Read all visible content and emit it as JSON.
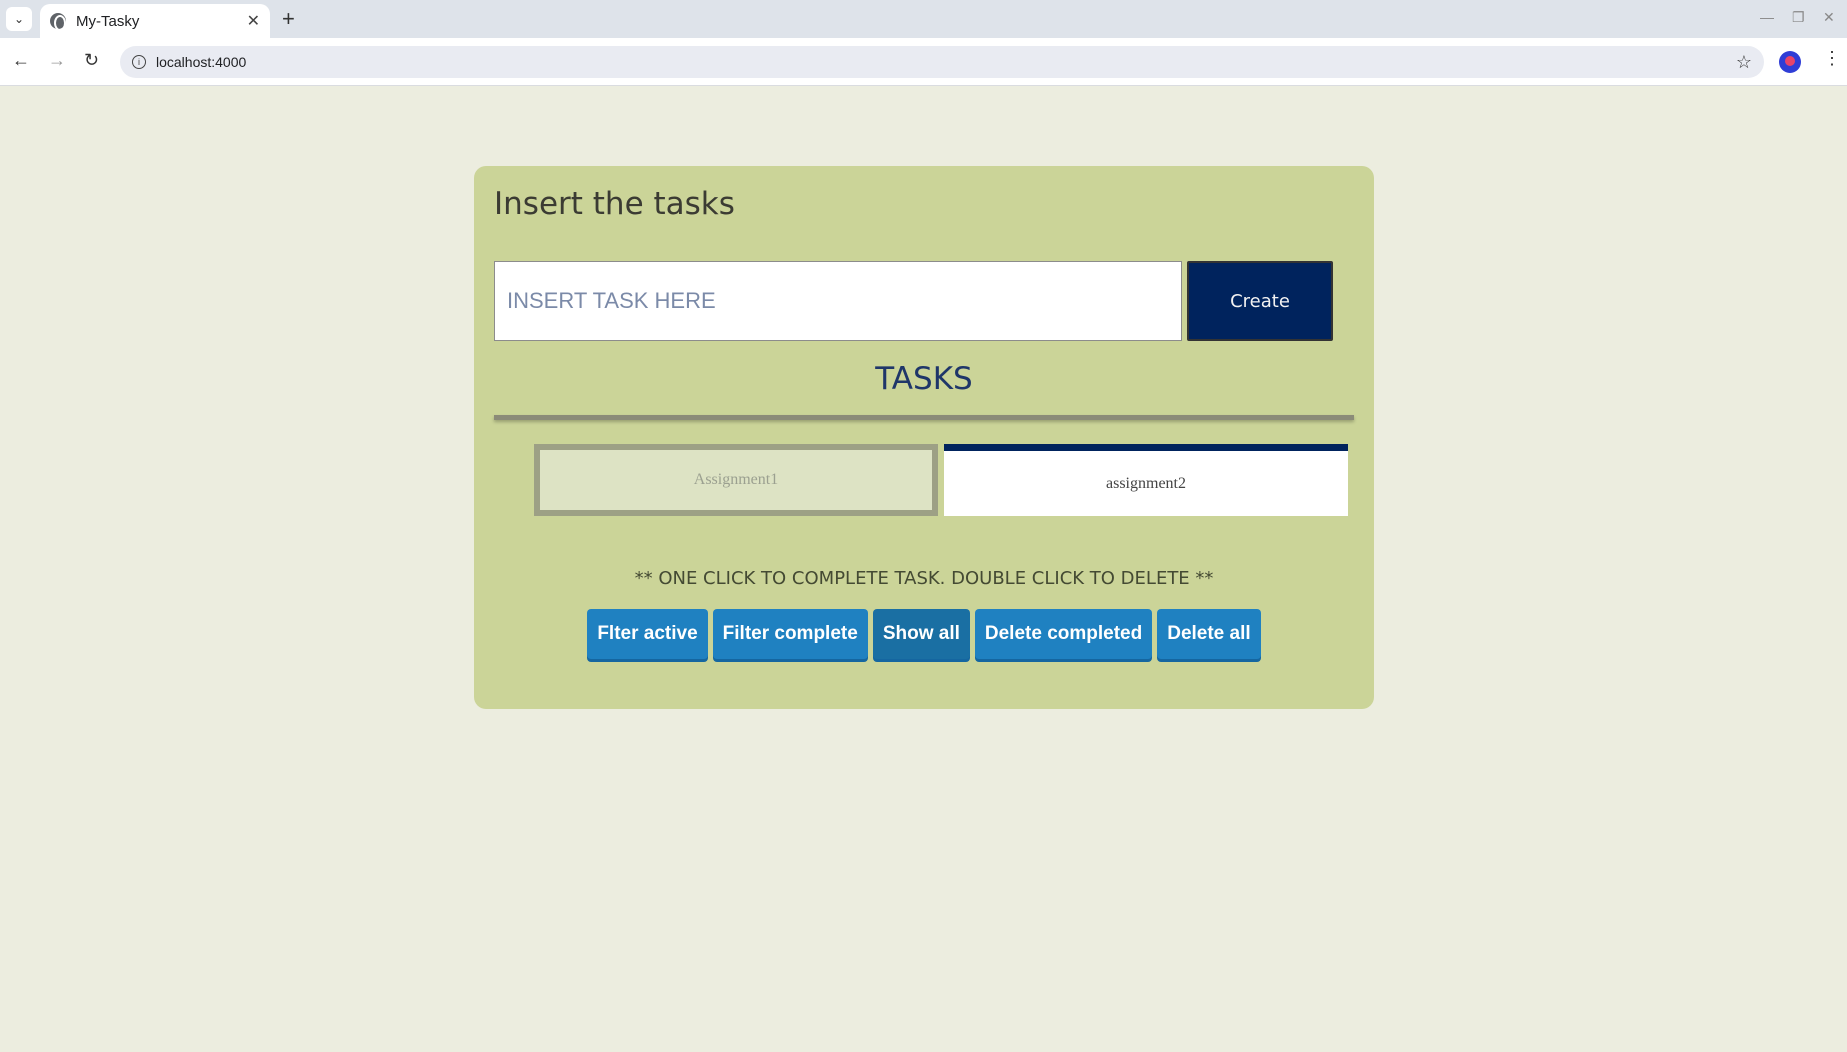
{
  "browser": {
    "tab_title": "My-Tasky",
    "url": "localhost:4000",
    "new_tab_symbol": "+",
    "close_symbol": "✕"
  },
  "app": {
    "title": "Insert the tasks",
    "input": {
      "value": "",
      "placeholder": "INSERT TASK HERE"
    },
    "create_label": "Create",
    "tasks_heading": "TASKS",
    "tasks": [
      {
        "label": "Assignment1",
        "completed": true
      },
      {
        "label": "assignment2",
        "completed": false
      }
    ],
    "hint": "** ONE CLICK TO COMPLETE TASK. DOUBLE CLICK TO DELETE **",
    "buttons": {
      "filter_active": "Flter active",
      "filter_complete": "Filter complete",
      "show_all": "Show all",
      "delete_completed": "Delete completed",
      "delete_all": "Delete all"
    }
  },
  "colors": {
    "page_bg": "#eceddf",
    "card_bg": "#cbd498",
    "accent_navy": "#00235d",
    "button_blue": "#1f81c1"
  }
}
